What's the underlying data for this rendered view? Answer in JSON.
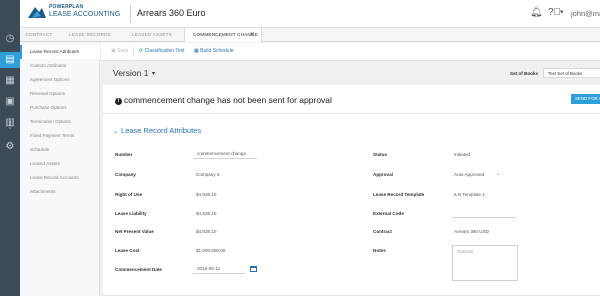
{
  "header": {
    "brand_line1": "POWERPLAN",
    "brand_line2": "LEASE ACCOUNTING",
    "workspace_title": "Arrears 360 Euro",
    "user_email": "john@mail.com"
  },
  "tabs": [
    {
      "label": "CONTRACT"
    },
    {
      "label": "LEASE RECORDS"
    },
    {
      "label": "LEASED ASSETS"
    },
    {
      "label": "COMMENCEMENT CHANGE",
      "active": true
    }
  ],
  "nav": [
    {
      "label": "Lease Record Attributes",
      "selected": true
    },
    {
      "label": "Custom Attributes"
    },
    {
      "label": "Agreement Options"
    },
    {
      "label": "Renewal Options"
    },
    {
      "label": "Purchase Options"
    },
    {
      "label": "Termination Options"
    },
    {
      "label": "Fixed Payment Terms"
    },
    {
      "label": "Schedule"
    },
    {
      "label": "Leased Assets"
    },
    {
      "label": "Lease Record Accounts"
    },
    {
      "label": "Attachments"
    }
  ],
  "toolbar": {
    "save": "Save",
    "classification_test": "Classification Test",
    "build_schedule": "Build Schedule"
  },
  "version": {
    "label": "Version 1",
    "set_of_books_label": "Set of Books",
    "set_of_books_value": "Test Set of Books"
  },
  "alert": {
    "message": "commencement change has not been sent for approval",
    "send_button": "SEND FOR APPROVAL"
  },
  "section": {
    "title": "Lease Record Attributes"
  },
  "fields_left": [
    {
      "label": "Number",
      "value": "commencement change"
    },
    {
      "label": "Company",
      "value": "Company 3"
    },
    {
      "label": "Right of Use",
      "value": "$4,938.10"
    },
    {
      "label": "Lease Liability",
      "value": "$4,938.10"
    },
    {
      "label": "Net Present Value",
      "value": "$4,938.10"
    },
    {
      "label": "Lease Cost",
      "value": "$1,000,000.00"
    },
    {
      "label": "Commencement Date",
      "value": "2018-06-11"
    }
  ],
  "fields_right": [
    {
      "label": "Status",
      "value": "Initiated"
    },
    {
      "label": "Approval",
      "value": "Auto Approved"
    },
    {
      "label": "Lease Record Template",
      "value": "ILR Template 1"
    },
    {
      "label": "External Code",
      "value": ""
    },
    {
      "label": "Contract",
      "value": "Arrears 360 USD"
    },
    {
      "label": "Notes",
      "placeholder": "Optional"
    }
  ],
  "colors": {
    "accent": "#2e9fd8",
    "link": "#2a73b4",
    "rail": "#3d4b58"
  }
}
